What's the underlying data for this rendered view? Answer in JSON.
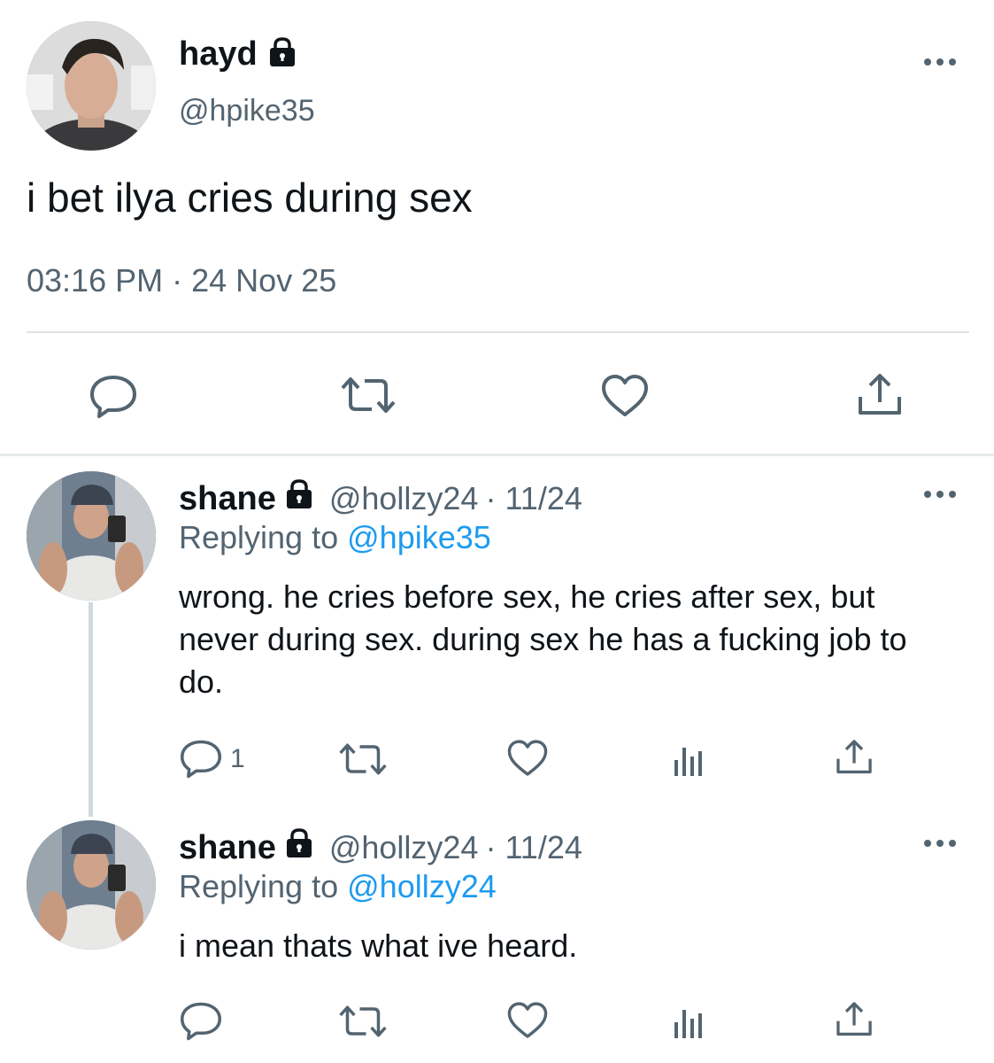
{
  "main_tweet": {
    "display_name": "hayd",
    "handle": "@hpike35",
    "text": "i bet ilya cries during sex",
    "time": "03:16 PM",
    "separator": "·",
    "date": "24 Nov 25",
    "actions": {
      "reply_icon": "reply-icon",
      "retweet_icon": "retweet-icon",
      "like_icon": "heart-icon",
      "share_icon": "share-icon"
    }
  },
  "replies": [
    {
      "display_name": "shane",
      "handle": "@hollzy24",
      "date": "· 11/24",
      "replying_prefix": "Replying to",
      "replying_to": "@hpike35",
      "text": "wrong. he cries before sex, he cries after sex, but never during sex. during sex he has a fucking job to do.",
      "reply_count": "1"
    },
    {
      "display_name": "shane",
      "handle": "@hollzy24",
      "date": "· 11/24",
      "replying_prefix": "Replying to",
      "replying_to": "@hollzy24",
      "text": "i mean thats what ive heard.",
      "reply_count": ""
    }
  ],
  "colors": {
    "text": "#0f1419",
    "secondary": "#536471",
    "link": "#1d9bf0",
    "divider": "#e6eaed"
  }
}
